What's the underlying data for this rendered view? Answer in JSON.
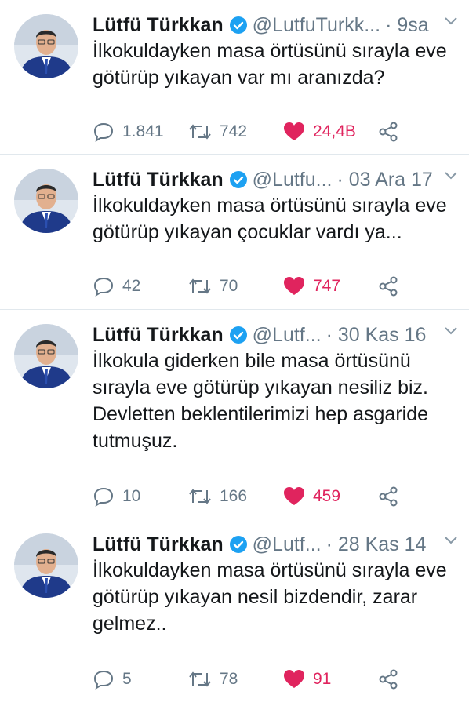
{
  "colors": {
    "verified": "#1da1f2",
    "like": "#e0245e",
    "muted": "#657786",
    "divider": "#e1e8ed"
  },
  "icons": {
    "verified": "verified-badge-icon",
    "reply": "reply-bubble-icon",
    "retweet": "retweet-icon",
    "like": "heart-icon",
    "share": "share-icon",
    "menu": "chevron-down-icon"
  },
  "tweets": [
    {
      "name": "Lütfü Türkkan",
      "handle": "@LutfuTurkk...",
      "time": "· 9sa",
      "text": "İlkokuldayken masa örtüsünü sırayla eve götürüp yıkayan var mı aranızda?",
      "replies": "1.841",
      "retweets": "742",
      "likes": "24,4B"
    },
    {
      "name": "Lütfü Türkkan",
      "handle": "@Lutfu...",
      "time": "· 03 Ara 17",
      "text": "İlkokuldayken masa örtüsünü sırayla eve götürüp yıkayan çocuklar vardı ya...",
      "replies": "42",
      "retweets": "70",
      "likes": "747"
    },
    {
      "name": "Lütfü Türkkan",
      "handle": "@Lutf...",
      "time": "· 30 Kas 16",
      "text": "İlkokula giderken bile masa örtüsünü sırayla eve götürüp yıkayan nesiliz biz. Devletten beklentilerimizi hep asgaride tutmuşuz.",
      "replies": "10",
      "retweets": "166",
      "likes": "459"
    },
    {
      "name": "Lütfü Türkkan",
      "handle": "@Lutf...",
      "time": "· 28 Kas 14",
      "text": "İlkokuldayken masa örtüsünü sırayla eve götürüp yıkayan nesil bizdendir, zarar gelmez..",
      "replies": "5",
      "retweets": "78",
      "likes": "91"
    }
  ]
}
